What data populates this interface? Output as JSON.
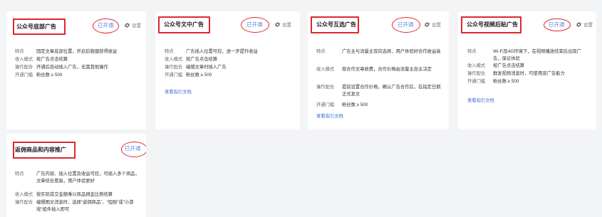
{
  "settings_label": "设置",
  "colors": {
    "page_bg": "#f3f4f6",
    "card_bg": "#ffffff",
    "highlight": "#e0262d",
    "status_text": "#5b84e0",
    "link": "#3e6fd9"
  },
  "cards": [
    {
      "title": "公众号底部广告",
      "status": "已开通",
      "rows": [
        {
          "key": "特点",
          "value": "固定文章底部位置，开启后稳健获得收益"
        },
        {
          "key": "收入模式",
          "value": "按广告点击结算"
        },
        {
          "key": "操作配合",
          "value": "开通后自动插入广告，无需其他操作"
        },
        {
          "key": "开通门槛",
          "value": "粉丝数 ≥ 500"
        }
      ],
      "link": ""
    },
    {
      "title": "公众号文中广告",
      "status": "已开通",
      "rows": [
        {
          "key": "特点",
          "value": "广告插入位置可控，进一步提升收益"
        },
        {
          "key": "收入模式",
          "value": "按广告点击结算"
        },
        {
          "key": "操作配合",
          "value": "编辑文章时插入广告"
        },
        {
          "key": "开通门槛",
          "value": "粉丝数 ≥ 500"
        }
      ],
      "link": "查看指引文档"
    },
    {
      "title": "公众号互选广告",
      "status": "已开通",
      "rows": [
        {
          "key": "特点",
          "value": "广告主与流量主双向选择，用户体验好合作收益高"
        },
        {
          "key": "收入模式",
          "value": "按合作文章收费，合作价格由流量主自主决定"
        },
        {
          "key": "操作配合",
          "value": "提前设置合作价格，确认广告合作后，在指定日期正式发文"
        },
        {
          "key": "开通门槛",
          "value": "粉丝数 ≥ 500"
        }
      ],
      "link": "查看指引文档"
    },
    {
      "title": "公众号视频后贴广告",
      "status": "已开通",
      "rows": [
        {
          "key": "特点",
          "value": "Wi-Fi及4G环境下，在视频播放结束后出现广告，保证体验"
        },
        {
          "key": "收入模式",
          "value": "按广告点击结算"
        },
        {
          "key": "操作配合",
          "value": "群发视频消息时，可使用该广告能力"
        },
        {
          "key": "开通门槛",
          "value": "粉丝数 ≥ 500"
        }
      ],
      "link": "查看指引文档"
    },
    {
      "title": "返佣商品和内容推广",
      "status": "已开通",
      "rows": [
        {
          "key": "特点",
          "value": "广告内容、插入位置及收益可控，可插入多个商品，文章结合度高，用户体验更好"
        },
        {
          "key": "收入模式",
          "value": "按实际成交金额乘以商品佣金比例结算"
        },
        {
          "key": "操作配合",
          "value": "编辑图文消息时，选择“返佣商品”、“短剧”或“小游戏”组件插入即可"
        }
      ],
      "link": ""
    }
  ]
}
